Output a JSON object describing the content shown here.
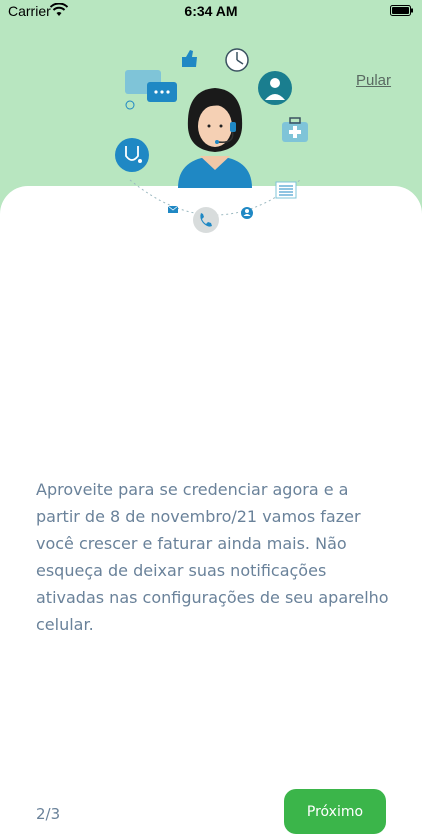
{
  "status_bar": {
    "carrier": "Carrier",
    "time": "6:34 AM"
  },
  "header": {
    "skip_label": "Pular"
  },
  "main": {
    "message": "Aproveite para se credenciar agora e a partir de 8 de novembro/21 vamos fazer você crescer e faturar ainda mais.  Não esqueça de deixar suas notificações ativadas nas configurações de seu aparelho celular.",
    "page_indicator": "2/3",
    "next_label": "Próximo"
  },
  "icons": [
    "wifi-icon",
    "battery-icon",
    "support-agent-illustration",
    "chat-bubble-icon",
    "thumbs-up-icon",
    "clock-icon",
    "doctor-icon",
    "first-aid-kit-icon",
    "stethoscope-icon",
    "phone-icon",
    "mail-icon",
    "user-icon",
    "document-icon"
  ],
  "colors": {
    "background_top": "#b8e6c0",
    "accent": "#3bb54a",
    "text": "#6a829a"
  }
}
